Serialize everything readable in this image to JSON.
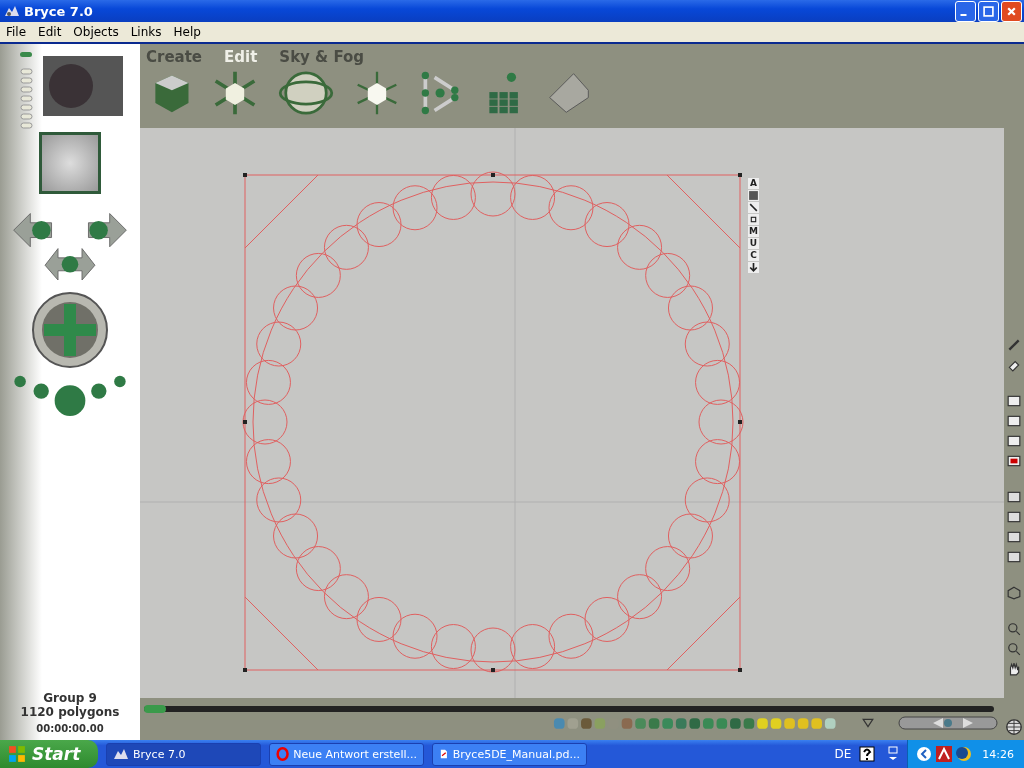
{
  "window": {
    "title": "Bryce 7.0"
  },
  "menu": [
    "File",
    "Edit",
    "Objects",
    "Links",
    "Help"
  ],
  "palette_tabs": [
    {
      "label": "Create",
      "selected": false
    },
    {
      "label": "Edit",
      "selected": true
    },
    {
      "label": "Sky & Fog",
      "selected": false
    }
  ],
  "view_controls": [
    {
      "kind": "letter",
      "label": "A"
    },
    {
      "kind": "square"
    },
    {
      "kind": "nodes"
    },
    {
      "kind": "frame"
    },
    {
      "kind": "letter",
      "label": "M"
    },
    {
      "kind": "letter",
      "label": "U"
    },
    {
      "kind": "letter",
      "label": "C"
    },
    {
      "kind": "arrow"
    }
  ],
  "status": {
    "object": "Group 9",
    "polygons": "1120 polygons",
    "time": "00:00:00.00"
  },
  "taskbar": {
    "start": "Start",
    "tasks": [
      {
        "label": "Bryce 7.0",
        "selected": true,
        "kind": "app"
      },
      {
        "label": "Neue Antwort erstell...",
        "selected": false,
        "kind": "browser"
      },
      {
        "label": "Bryce5DE_Manual.pd...",
        "selected": false,
        "kind": "pdf"
      }
    ],
    "language": "DE",
    "clock": "14:26"
  }
}
